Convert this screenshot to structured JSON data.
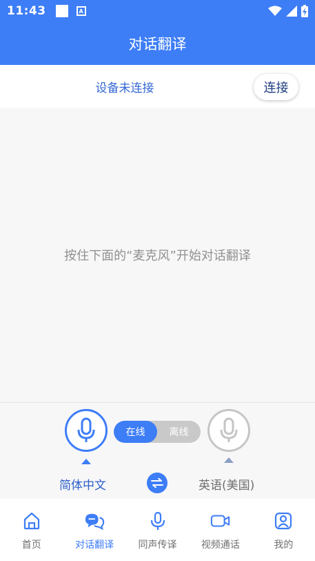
{
  "status_bar": {
    "time": "11:43",
    "notif_letter": "A"
  },
  "header": {
    "title": "对话翻译"
  },
  "device": {
    "status_text": "设备未连接",
    "connect_label": "连接"
  },
  "main": {
    "hint": "按住下面的“麦克风”开始对话翻译"
  },
  "controls": {
    "mode_online": "在线",
    "mode_offline": "离线",
    "selected_mode": "在线",
    "source_language": "简体中文",
    "target_language": "英语(美国)"
  },
  "nav": {
    "items": [
      {
        "label": "首页",
        "icon": "home-icon"
      },
      {
        "label": "对话翻译",
        "icon": "chat-icon"
      },
      {
        "label": "同声传译",
        "icon": "microphone-icon"
      },
      {
        "label": "视频通话",
        "icon": "video-camera-icon"
      },
      {
        "label": "我的",
        "icon": "user-icon"
      }
    ],
    "active_index": 1
  },
  "colors": {
    "primary": "#3d7df6",
    "inactive_gray": "#c5c5c5",
    "status_blue_text": "#3568d4"
  }
}
